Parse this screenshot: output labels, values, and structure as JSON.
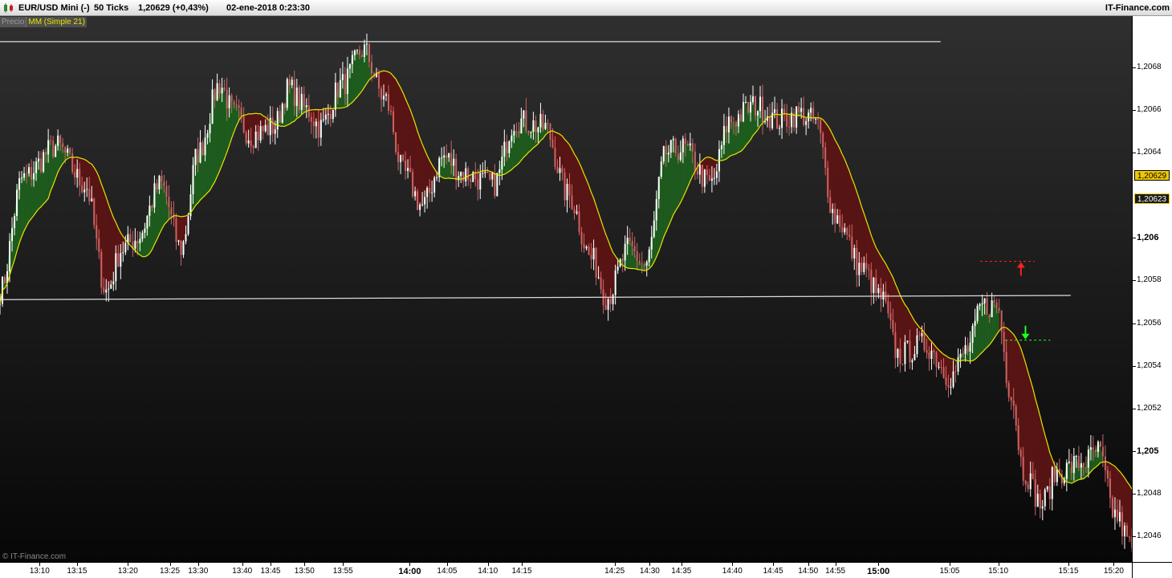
{
  "titlebar": {
    "instrument": "EUR/USD Mini (-)",
    "timeframe": "50 Ticks",
    "quote": "1,20629 (+0,43%)",
    "datetime": "02-ene-2018 0:23:30",
    "brand": "IT-Finance.com"
  },
  "legend": {
    "price_label": "Precio",
    "ma_label": "MM (Simple 21)"
  },
  "watermark": "© IT-Finance.com",
  "colors": {
    "ma_line": "#e6e600",
    "fill_above": "#1e5c1e",
    "fill_below": "#5a1414",
    "candle_up": "#ffffff",
    "candle_down": "#c86464",
    "hline": "#dddddd",
    "stop_red": "#ff2020",
    "target_green": "#20ff20",
    "last_price_box": "#f0c800"
  },
  "price_axis": {
    "labels": [
      {
        "text": "1,2068",
        "value": 1.2068,
        "bold": false
      },
      {
        "text": "1,2066",
        "value": 1.2066,
        "bold": false
      },
      {
        "text": "1,2064",
        "value": 1.2064,
        "bold": false
      },
      {
        "text": "1,206",
        "value": 1.206,
        "bold": true
      },
      {
        "text": "1,2058",
        "value": 1.2058,
        "bold": false
      },
      {
        "text": "1,2056",
        "value": 1.2056,
        "bold": false
      },
      {
        "text": "1,2054",
        "value": 1.2054,
        "bold": false
      },
      {
        "text": "1,2052",
        "value": 1.2052,
        "bold": false
      },
      {
        "text": "1,205",
        "value": 1.205,
        "bold": true
      },
      {
        "text": "1,2048",
        "value": 1.2048,
        "bold": false
      },
      {
        "text": "1,2046",
        "value": 1.2046,
        "bold": false
      }
    ],
    "last_price": {
      "text": "1,20629",
      "value": 1.20629
    },
    "second_price": {
      "text": "1,20623",
      "value": 1.20618
    }
  },
  "time_axis": {
    "labels": [
      {
        "text": "13:10",
        "pos": 0.035,
        "bold": false
      },
      {
        "text": "13:15",
        "pos": 0.068,
        "bold": false
      },
      {
        "text": "13:20",
        "pos": 0.113,
        "bold": false
      },
      {
        "text": "13:25",
        "pos": 0.15,
        "bold": false
      },
      {
        "text": "13:30",
        "pos": 0.175,
        "bold": false
      },
      {
        "text": "13:40",
        "pos": 0.214,
        "bold": false
      },
      {
        "text": "13:45",
        "pos": 0.239,
        "bold": false
      },
      {
        "text": "13:50",
        "pos": 0.269,
        "bold": false
      },
      {
        "text": "13:55",
        "pos": 0.303,
        "bold": false
      },
      {
        "text": "14:00",
        "pos": 0.362,
        "bold": true
      },
      {
        "text": "14:05",
        "pos": 0.395,
        "bold": false
      },
      {
        "text": "14:10",
        "pos": 0.431,
        "bold": false
      },
      {
        "text": "14:15",
        "pos": 0.461,
        "bold": false
      },
      {
        "text": "14:25",
        "pos": 0.543,
        "bold": false
      },
      {
        "text": "14:30",
        "pos": 0.574,
        "bold": false
      },
      {
        "text": "14:35",
        "pos": 0.602,
        "bold": false
      },
      {
        "text": "14:40",
        "pos": 0.647,
        "bold": false
      },
      {
        "text": "14:45",
        "pos": 0.683,
        "bold": false
      },
      {
        "text": "14:50",
        "pos": 0.714,
        "bold": false
      },
      {
        "text": "14:55",
        "pos": 0.738,
        "bold": false
      },
      {
        "text": "15:00",
        "pos": 0.776,
        "bold": true
      },
      {
        "text": "15:05",
        "pos": 0.839,
        "bold": false
      },
      {
        "text": "15:10",
        "pos": 0.882,
        "bold": false
      },
      {
        "text": "15:15",
        "pos": 0.944,
        "bold": false
      },
      {
        "text": "15:20",
        "pos": 0.984,
        "bold": false
      }
    ]
  },
  "chart_data": {
    "type": "line",
    "chart_style": "candlestick",
    "indicator": "MM (Simple 21)",
    "ylim": [
      1.20448,
      1.20704
    ],
    "price_anchors": [
      {
        "x": 0.0,
        "p": 1.20575
      },
      {
        "x": 0.02,
        "p": 1.20628
      },
      {
        "x": 0.05,
        "p": 1.20643
      },
      {
        "x": 0.075,
        "p": 1.20625
      },
      {
        "x": 0.094,
        "p": 1.20575
      },
      {
        "x": 0.108,
        "p": 1.20595
      },
      {
        "x": 0.121,
        "p": 1.206
      },
      {
        "x": 0.142,
        "p": 1.20625
      },
      {
        "x": 0.16,
        "p": 1.20595
      },
      {
        "x": 0.175,
        "p": 1.2064
      },
      {
        "x": 0.194,
        "p": 1.20672
      },
      {
        "x": 0.207,
        "p": 1.20658
      },
      {
        "x": 0.222,
        "p": 1.20648
      },
      {
        "x": 0.242,
        "p": 1.20652
      },
      {
        "x": 0.255,
        "p": 1.2067
      },
      {
        "x": 0.271,
        "p": 1.2066
      },
      {
        "x": 0.283,
        "p": 1.20652
      },
      {
        "x": 0.302,
        "p": 1.20672
      },
      {
        "x": 0.321,
        "p": 1.20688
      },
      {
        "x": 0.34,
        "p": 1.20665
      },
      {
        "x": 0.357,
        "p": 1.2063
      },
      {
        "x": 0.373,
        "p": 1.20615
      },
      {
        "x": 0.392,
        "p": 1.20638
      },
      {
        "x": 0.41,
        "p": 1.2063
      },
      {
        "x": 0.436,
        "p": 1.20625
      },
      {
        "x": 0.455,
        "p": 1.20655
      },
      {
        "x": 0.481,
        "p": 1.20652
      },
      {
        "x": 0.502,
        "p": 1.2062
      },
      {
        "x": 0.523,
        "p": 1.2059
      },
      {
        "x": 0.536,
        "p": 1.20572
      },
      {
        "x": 0.556,
        "p": 1.20595
      },
      {
        "x": 0.57,
        "p": 1.20587
      },
      {
        "x": 0.589,
        "p": 1.2064
      },
      {
        "x": 0.603,
        "p": 1.20642
      },
      {
        "x": 0.628,
        "p": 1.20625
      },
      {
        "x": 0.645,
        "p": 1.20655
      },
      {
        "x": 0.667,
        "p": 1.20662
      },
      {
        "x": 0.688,
        "p": 1.20655
      },
      {
        "x": 0.706,
        "p": 1.20658
      },
      {
        "x": 0.72,
        "p": 1.20655
      },
      {
        "x": 0.738,
        "p": 1.2061
      },
      {
        "x": 0.762,
        "p": 1.20585
      },
      {
        "x": 0.778,
        "p": 1.20572
      },
      {
        "x": 0.794,
        "p": 1.20545
      },
      {
        "x": 0.817,
        "p": 1.2055
      },
      {
        "x": 0.84,
        "p": 1.20535
      },
      {
        "x": 0.855,
        "p": 1.20548
      },
      {
        "x": 0.868,
        "p": 1.20568
      },
      {
        "x": 0.881,
        "p": 1.20568
      },
      {
        "x": 0.892,
        "p": 1.2053
      },
      {
        "x": 0.905,
        "p": 1.2049
      },
      {
        "x": 0.92,
        "p": 1.20475
      },
      {
        "x": 0.934,
        "p": 1.2049
      },
      {
        "x": 0.958,
        "p": 1.20495
      },
      {
        "x": 0.97,
        "p": 1.205
      },
      {
        "x": 0.985,
        "p": 1.2047
      },
      {
        "x": 1.0,
        "p": 1.20455
      }
    ],
    "horizontal_lines": [
      {
        "p_start": 1.20692,
        "p_end": 1.20692,
        "x_start": 0.0,
        "x_end": 0.831
      },
      {
        "p_start": 1.20571,
        "p_end": 1.20573,
        "x_start": 0.0,
        "x_end": 0.946
      }
    ],
    "stop_marker": {
      "p": 1.20589,
      "x_start": 0.866,
      "x_end": 0.914,
      "arrow_x": 0.902,
      "direction": "up"
    },
    "target_marker": {
      "p": 1.20552,
      "x_start": 0.888,
      "x_end": 0.928,
      "arrow_x": 0.906,
      "direction": "down"
    },
    "candle_count": 470,
    "ma_period": 21
  }
}
